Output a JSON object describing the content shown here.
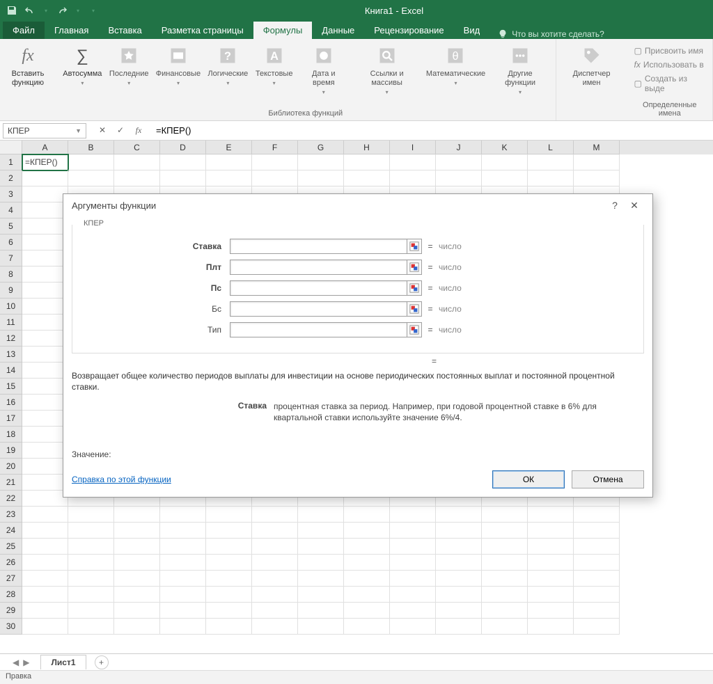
{
  "app": {
    "title": "Книга1 - Excel"
  },
  "tabs": {
    "file": "Файл",
    "items": [
      "Главная",
      "Вставка",
      "Разметка страницы",
      "Формулы",
      "Данные",
      "Рецензирование",
      "Вид"
    ],
    "active": "Формулы",
    "tellme": "Что вы хотите сделать?"
  },
  "ribbon": {
    "insert_fn": "Вставить функцию",
    "autosum": "Автосумма",
    "recent": "Последние",
    "financial": "Финансовые",
    "logical": "Логические",
    "text": "Текстовые",
    "datetime": "Дата и время",
    "lookup": "Ссылки и массивы",
    "math": "Математические",
    "more": "Другие функции",
    "group_lib": "Библиотека функций",
    "name_mgr": "Диспетчер имен",
    "define": "Присвоить имя",
    "usein": "Использовать в",
    "create": "Создать из выде",
    "group_names": "Определенные имена"
  },
  "formula_bar": {
    "namebox": "КПЕР",
    "formula": "=КПЕР()"
  },
  "grid": {
    "cols": [
      "A",
      "B",
      "C",
      "D",
      "E",
      "F",
      "G",
      "H",
      "I",
      "J",
      "K",
      "L",
      "M"
    ],
    "rows": 30,
    "active_cell_value": "=КПЕР()"
  },
  "sheet": {
    "tab1": "Лист1"
  },
  "statusbar": {
    "mode": "Правка"
  },
  "dialog": {
    "title": "Аргументы функции",
    "func_name": "КПЕР",
    "args": [
      {
        "label": "Ставка",
        "bold": true,
        "type": "число"
      },
      {
        "label": "Плт",
        "bold": true,
        "type": "число"
      },
      {
        "label": "Пс",
        "bold": true,
        "type": "число"
      },
      {
        "label": "Бс",
        "bold": false,
        "type": "число"
      },
      {
        "label": "Тип",
        "bold": false,
        "type": "число"
      }
    ],
    "result_eq": "=",
    "desc": "Возвращает общее количество периодов выплаты для инвестиции на основе периодических постоянных выплат и постоянной процентной ставки.",
    "arg_help_name": "Ставка",
    "arg_help_text": "процентная ставка за период. Например, при годовой процентной ставке в 6% для квартальной ставки используйте значение 6%/4.",
    "value_label": "Значение:",
    "help_link": "Справка по этой функции",
    "ok": "ОК",
    "cancel": "Отмена"
  }
}
